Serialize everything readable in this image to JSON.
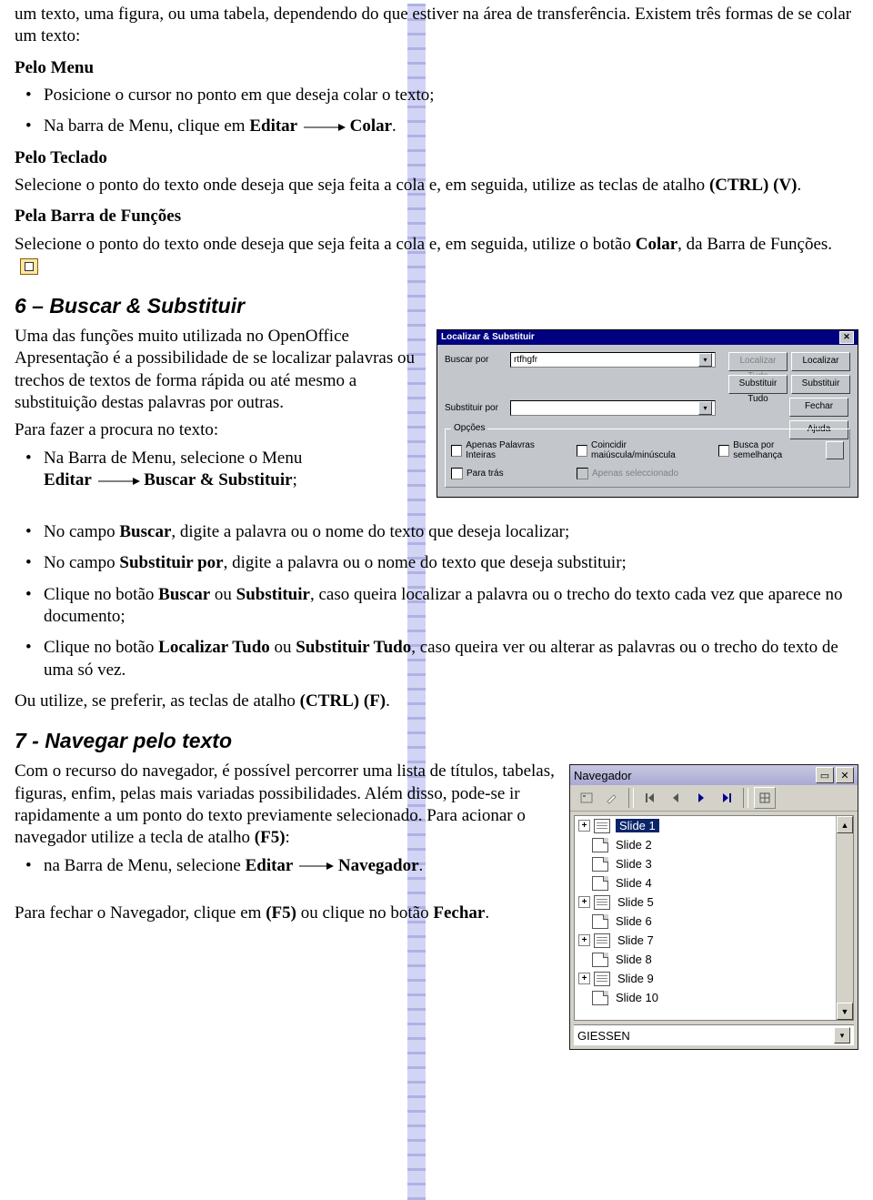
{
  "intro": "um texto, uma figura, ou uma tabela, dependendo do que estiver na área de transferência. Existem três formas de se colar um texto:",
  "s1": {
    "h": "Pelo Menu",
    "b1": "Posicione o cursor no ponto em que deseja colar o texto;",
    "b2a": "Na barra de Menu, clique em ",
    "b2b": "Editar",
    "b2c": "Colar",
    "b2d": "."
  },
  "s2": {
    "h": "Pelo Teclado",
    "p1a": "Selecione o ponto do texto onde deseja que seja feita a cola e, em seguida, utilize as teclas de atalho ",
    "p1b": "(CTRL) (V)",
    "p1c": "."
  },
  "s3": {
    "h": "Pela Barra de Funções",
    "p1a": "Selecione o ponto do texto onde deseja que seja feita a cola  e, em seguida, utilize o botão ",
    "p1b": "Colar",
    "p1c": ", da Barra de Funções."
  },
  "h6": "6 – Buscar & Substituir",
  "p6": "Uma das funções muito utilizada no OpenOffice Apresentação é a possibilidade de se localizar palavras ou trechos de textos de forma rápida ou até mesmo a substituição destas palavras por outras.",
  "p6b": "Para fazer a procura no texto:",
  "p6l1a": "Na Barra de Menu, selecione o Menu",
  "p6l1b": "Editar",
  "p6l1c": "Buscar & Substituir",
  "p6l1d": ";",
  "l1a": "No campo ",
  "l1b": "Buscar",
  "l1c": ", digite a palavra ou o nome do texto que deseja localizar;",
  "l2a": "No campo ",
  "l2b": "Substituir por",
  "l2c": ", digite a palavra ou o nome do texto que deseja substituir;",
  "l3a": "Clique no botão ",
  "l3b": "Buscar",
  "l3c": " ou ",
  "l3d": "Substituir",
  "l3e": ", caso queira localizar a palavra ou o trecho do texto  cada vez que aparece no documento;",
  "l4a": "Clique no botão ",
  "l4b": "Localizar Tudo",
  "l4c": " ou ",
  "l4d": "Substituir Tudo",
  "l4e": ", caso queira ver ou alterar as palavras ou o trecho do texto de uma só vez.",
  "p6c_a": "Ou utilize, se preferir, as teclas de atalho ",
  "p6c_b": "(CTRL) (F)",
  "p6c_c": ".",
  "h7": "7 - Navegar pelo texto",
  "p7a": "Com o recurso do navegador, é possível percorrer uma lista de títulos, tabelas, figuras, enfim, pelas mais variadas possibilidades. Além disso, pode-se ir rapidamente a um ponto do texto previamente selecionado. Para acionar o navegador utilize a tecla de atalho ",
  "p7b": "(F5)",
  "p7c": ":",
  "p7l1a": "na Barra de Menu, selecione ",
  "p7l1b": "Editar",
  "p7l1c": "Navegador",
  "p7l1d": ".",
  "p7e_a": "Para fechar o Navegador, clique em ",
  "p7e_b": "(F5)",
  "p7e_c": " ou clique no botão ",
  "p7e_d": "Fechar",
  "p7e_e": ".",
  "dialog_find": {
    "title": "Localizar & Substituir",
    "buscar_por": "Buscar por",
    "buscar_val": "rtfhgfr",
    "subst_por": "Substituir por",
    "btn_loc_tudo": "Localizar Tudo",
    "btn_loc": "Localizar",
    "btn_sub_tudo": "Substituir Tudo",
    "btn_sub": "Substituir",
    "btn_fechar": "Fechar",
    "btn_ajuda": "Ajuda",
    "grp": "Opções",
    "ck1": "Apenas Palavras Inteiras",
    "ck2": "Para trás",
    "ck3": "Coincidir maiúscula/minúscula",
    "ck4": "Apenas seleccionado",
    "ck5": "Busca por semelhança"
  },
  "nav": {
    "title": "Navegador",
    "items": [
      "Slide 1",
      "Slide 2",
      "Slide 3",
      "Slide 4",
      "Slide 5",
      "Slide 6",
      "Slide 7",
      "Slide 8",
      "Slide 9",
      "Slide 10"
    ],
    "expand": [
      true,
      false,
      false,
      false,
      true,
      false,
      true,
      false,
      true,
      false
    ],
    "doc": "GIESSEN"
  }
}
